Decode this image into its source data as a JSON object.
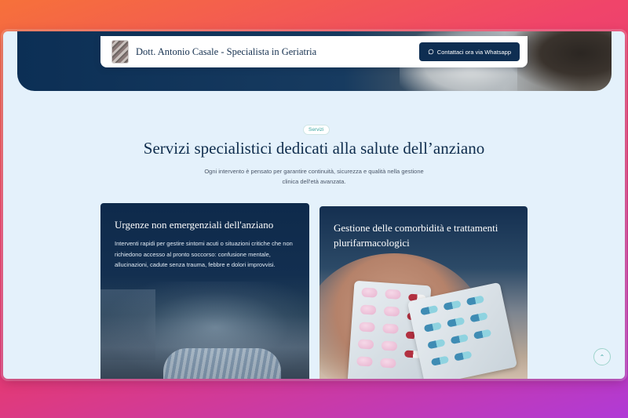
{
  "header": {
    "doctor_name": "Dott. Antonio Casale - Specialista in Geriatria",
    "whatsapp_button": "Contattaci ora via Whatsapp"
  },
  "services": {
    "badge": "Servizi",
    "title": "Servizi specialistici dedicati alla salute dell’anziano",
    "subtitle": "Ogni intervento è pensato per garantire continuità, sicurezza e qualità nella gestione clinica dell'età avanzata.",
    "cards": [
      {
        "title": "Urgenze non emergenziali dell'anziano",
        "description": "Interventi rapidi per gestire sintomi acuti o situazioni critiche che non richiedono accesso al pronto soccorso: confusione mentale, allucinazioni, cadute senza trauma, febbre e dolori improvvisi."
      },
      {
        "title": "Gestione delle comorbidità e trattamenti plurifarmacologici",
        "description": ""
      }
    ]
  },
  "icons": {
    "whatsapp": "whatsapp-icon",
    "scroll_top": "chevron-up-icon"
  },
  "colors": {
    "navy": "#0e2e52",
    "page_bg": "#e4f1fb",
    "accent_teal": "#3aa6a0"
  }
}
